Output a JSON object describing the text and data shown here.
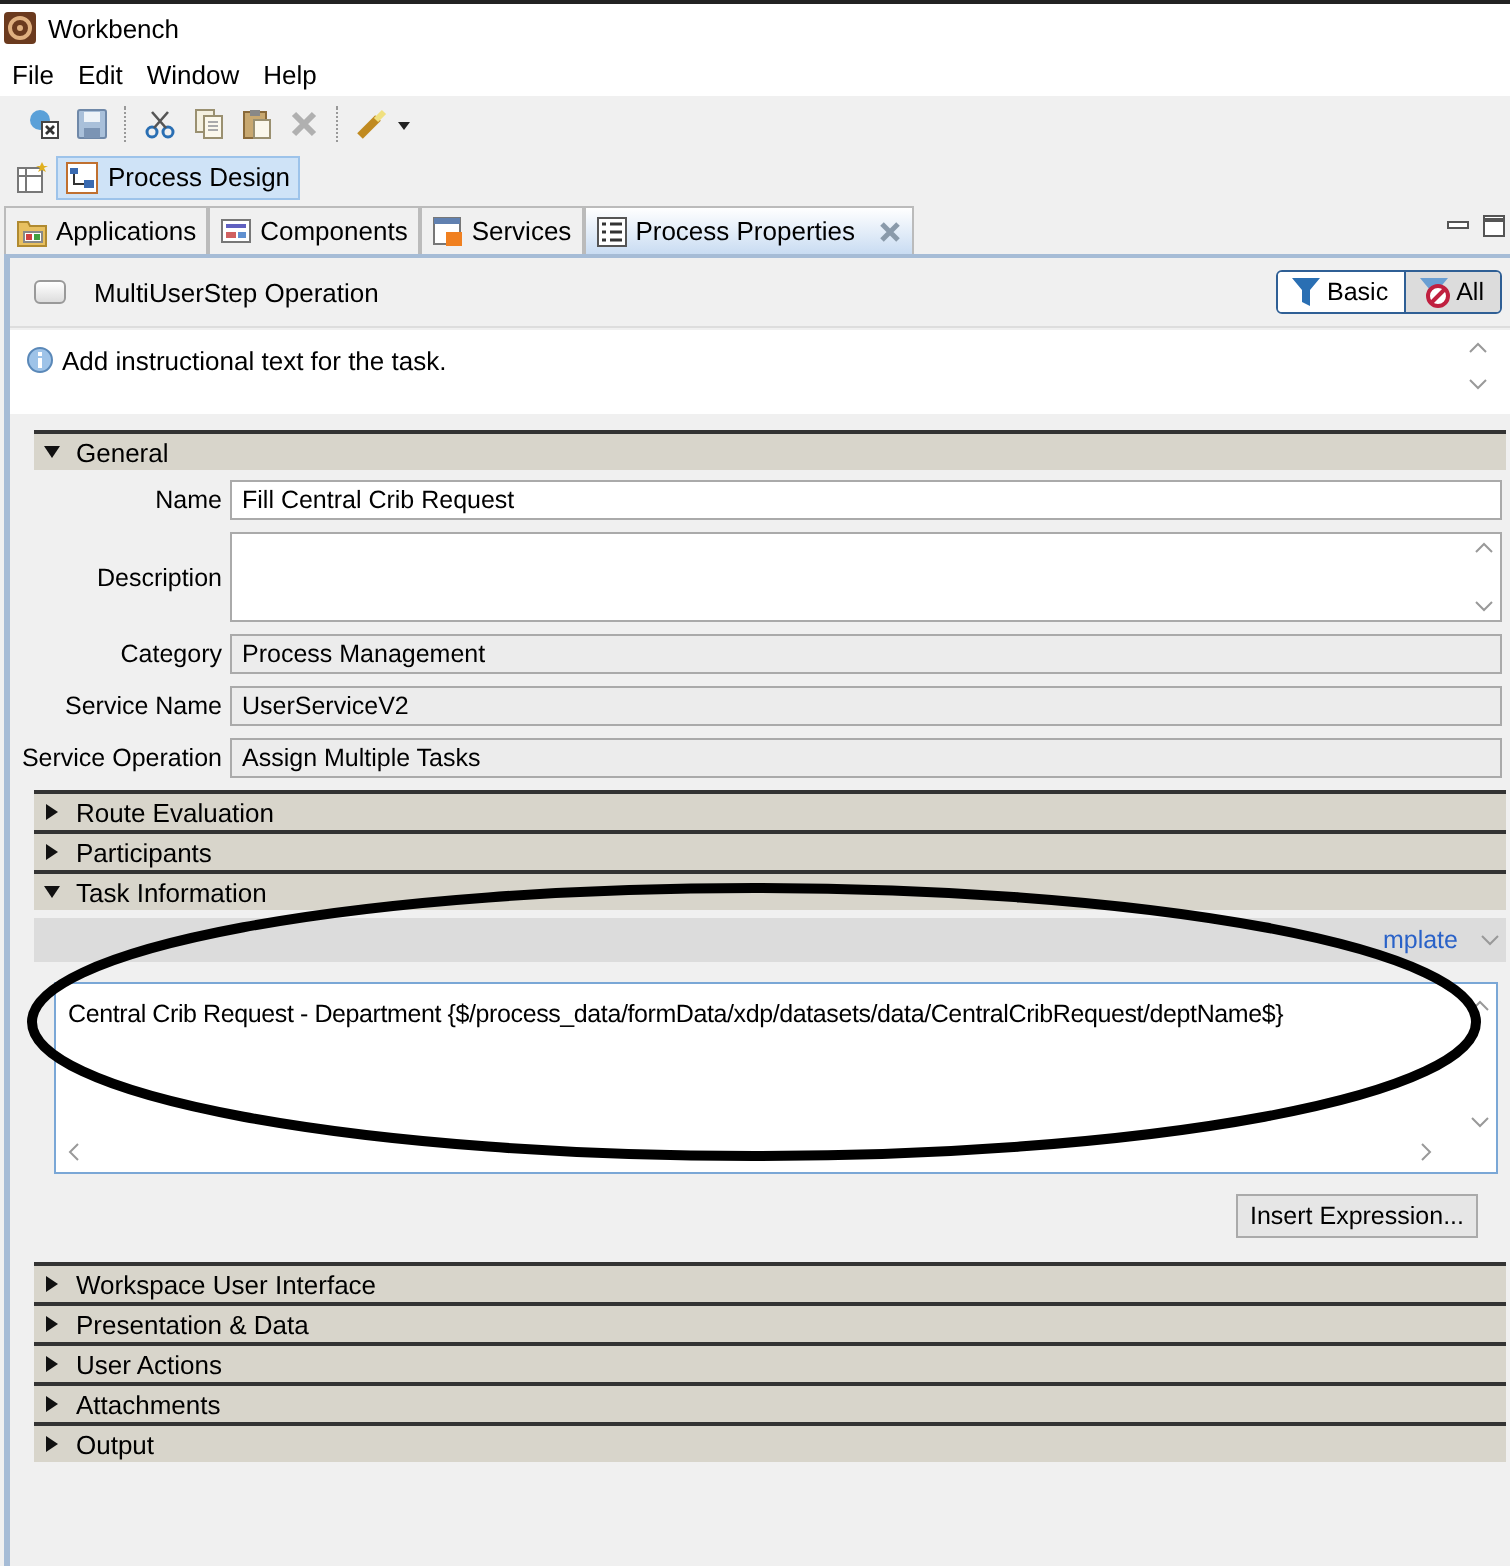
{
  "window": {
    "title": "Workbench"
  },
  "menu": [
    "File",
    "Edit",
    "Window",
    "Help"
  ],
  "perspective": {
    "label": "Process Design",
    "selected": true
  },
  "tabs": [
    {
      "label": "Applications",
      "selected": false
    },
    {
      "label": "Components",
      "selected": false
    },
    {
      "label": "Services",
      "selected": false
    },
    {
      "label": "Process Properties",
      "selected": true
    }
  ],
  "operation": {
    "label": "MultiUserStep Operation",
    "checked": false
  },
  "filters": [
    {
      "label": "Basic",
      "selected": false
    },
    {
      "label": "All",
      "selected": true
    }
  ],
  "info": "Add instructional text for the task.",
  "sections": [
    {
      "title": "General",
      "expanded": true,
      "fields": [
        {
          "label": "Name",
          "value": "Fill Central Crib Request",
          "disabled": false,
          "kind": "line"
        },
        {
          "label": "Description",
          "disabled": false,
          "kind": "area"
        },
        {
          "label": "Category",
          "value": "Process Management",
          "disabled": true,
          "kind": "line"
        },
        {
          "label": "Service Name",
          "value": "UserServiceV2",
          "disabled": true,
          "kind": "line"
        },
        {
          "label": "Service Operation",
          "value": "Assign Multiple Tasks",
          "disabled": true,
          "kind": "line"
        }
      ]
    },
    {
      "title": "Route Evaluation",
      "expanded": false
    },
    {
      "title": "Participants",
      "expanded": false
    },
    {
      "title": "Task Information",
      "expanded": true,
      "template_link": "mplate",
      "editor_text": "Central Crib Request - Department {$/process_data/formData/xdp/datasets/data/CentralCribRequest/deptName$}",
      "button": "Insert Expression..."
    },
    {
      "title": "Workspace User Interface",
      "expanded": false
    },
    {
      "title": "Presentation & Data",
      "expanded": false
    },
    {
      "title": "User Actions",
      "expanded": false
    },
    {
      "title": "Attachments",
      "expanded": false
    },
    {
      "title": "Output",
      "expanded": false
    }
  ]
}
